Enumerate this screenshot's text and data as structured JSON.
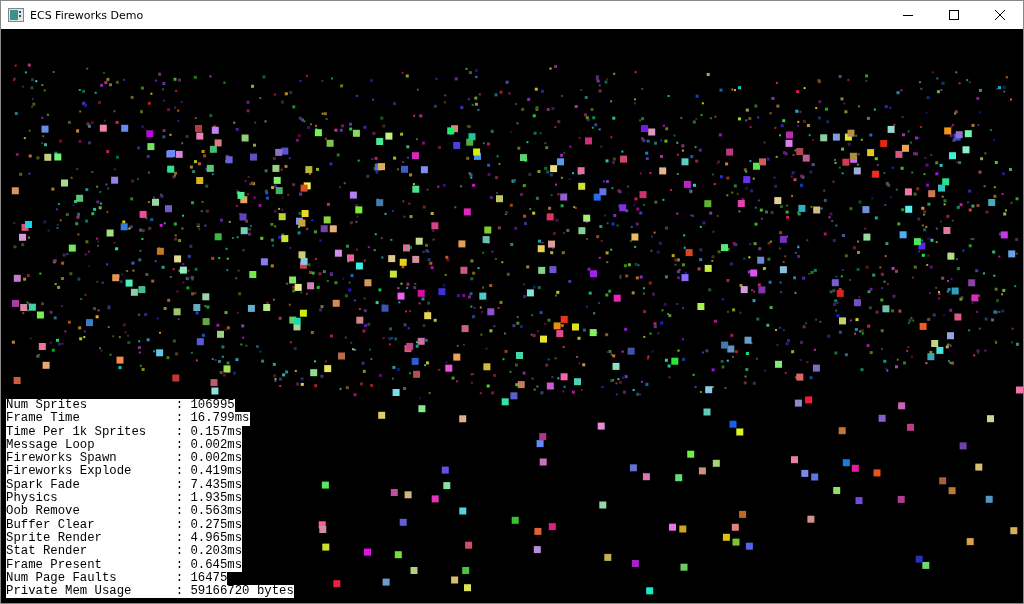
{
  "window": {
    "title": "ECS Fireworks Demo"
  },
  "stats": [
    {
      "label": "Num Sprites",
      "separator": ":",
      "value": "106995"
    },
    {
      "label": "Frame Time",
      "separator": ":",
      "value": "16.799ms"
    },
    {
      "label": "Time Per 1k Sprites",
      "separator": ":",
      "value": "0.157ms"
    },
    {
      "label": "Message Loop",
      "separator": ":",
      "value": "0.002ms"
    },
    {
      "label": "Fireworks Spawn",
      "separator": ":",
      "value": "0.002ms"
    },
    {
      "label": "Fireworks Explode",
      "separator": ":",
      "value": "0.419ms"
    },
    {
      "label": "Spark Fade",
      "separator": ":",
      "value": "7.435ms"
    },
    {
      "label": "Physics",
      "separator": ":",
      "value": "1.935ms"
    },
    {
      "label": "Oob Remove",
      "separator": ":",
      "value": "0.563ms"
    },
    {
      "label": "Buffer Clear",
      "separator": ":",
      "value": "0.275ms"
    },
    {
      "label": "Sprite Render",
      "separator": ":",
      "value": "4.965ms"
    },
    {
      "label": "Stat Render",
      "separator": ":",
      "value": "0.203ms"
    },
    {
      "label": "Frame Present",
      "separator": ":",
      "value": "0.645ms"
    },
    {
      "label": "Num Page Faults",
      "separator": ":",
      "value": "16475"
    },
    {
      "label": "Private Mem Usage",
      "separator": ":",
      "value": "59166720 bytes"
    }
  ]
}
